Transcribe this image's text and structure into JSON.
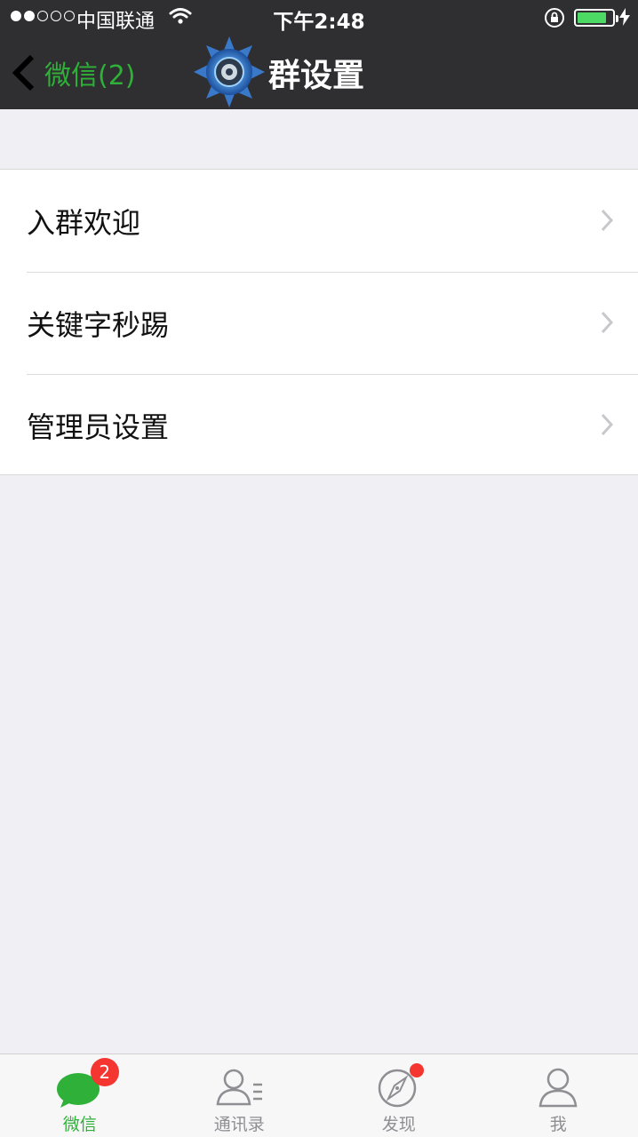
{
  "status_bar": {
    "carrier": "中国联通",
    "time": "下午2:48",
    "battery_level": 0.85
  },
  "nav": {
    "back_label": "微信(2)",
    "title": "群设置"
  },
  "settings": {
    "items": [
      {
        "label": "入群欢迎"
      },
      {
        "label": "关键字秒踢"
      },
      {
        "label": "管理员设置"
      }
    ]
  },
  "tabbar": {
    "tabs": [
      {
        "label": "微信",
        "badge": "2",
        "active": true
      },
      {
        "label": "通讯录"
      },
      {
        "label": "发现",
        "dot": true
      },
      {
        "label": "我"
      }
    ]
  },
  "colors": {
    "accent_green": "#2fb039",
    "badge_red": "#f43530",
    "nav_background": "#2f2f31"
  }
}
